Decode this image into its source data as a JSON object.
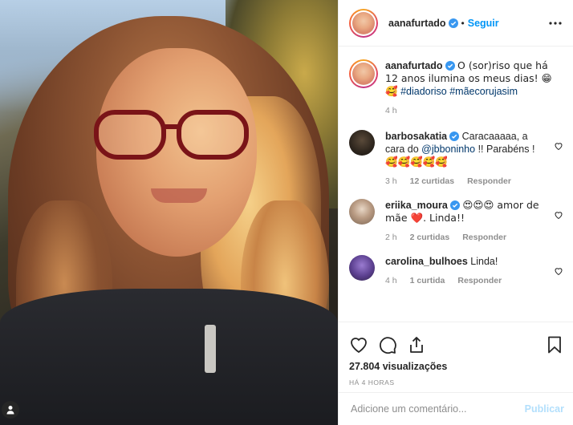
{
  "header": {
    "username": "aanafurtado",
    "separator": "•",
    "follow_label": "Seguir"
  },
  "caption": {
    "username": "aanafurtado",
    "text": "O (sor)riso que há 12 anos ilumina os meus dias! 😁🥰",
    "hashtags": [
      "#diadoriso",
      "#mãecorujasim"
    ],
    "time": "4 h"
  },
  "comments": [
    {
      "username": "barbosakatia",
      "verified": true,
      "text_before": "Caracaaaaa, a cara do ",
      "mention": "@jbboninho",
      "text_after": " !! Parabéns !",
      "emojis": "🥰🥰🥰🥰🥰",
      "time": "3 h",
      "likes": "12 curtidas",
      "reply": "Responder"
    },
    {
      "username": "eriika_moura",
      "verified": true,
      "text": "😍😍😍 amor de mãe ❤️. Linda!!",
      "time": "2 h",
      "likes": "2 curtidas",
      "reply": "Responder"
    },
    {
      "username": "carolina_bulhoes",
      "verified": false,
      "text": "Linda!",
      "time": "4 h",
      "likes": "1 curtida",
      "reply": "Responder"
    }
  ],
  "actions": {
    "views": "27.804 visualizações",
    "ago": "HÁ 4 HORAS"
  },
  "add_comment": {
    "placeholder": "Adicione um comentário...",
    "publish_label": "Publicar"
  },
  "colors": {
    "link_blue": "#0095f6",
    "hashtag": "#00376b",
    "muted": "#8e8e8e",
    "publish_disabled": "#b2dffc"
  },
  "icons": [
    "verified-icon",
    "more-options-icon",
    "heart-icon",
    "comment-icon",
    "share-icon",
    "bookmark-icon",
    "user-tag-icon"
  ]
}
